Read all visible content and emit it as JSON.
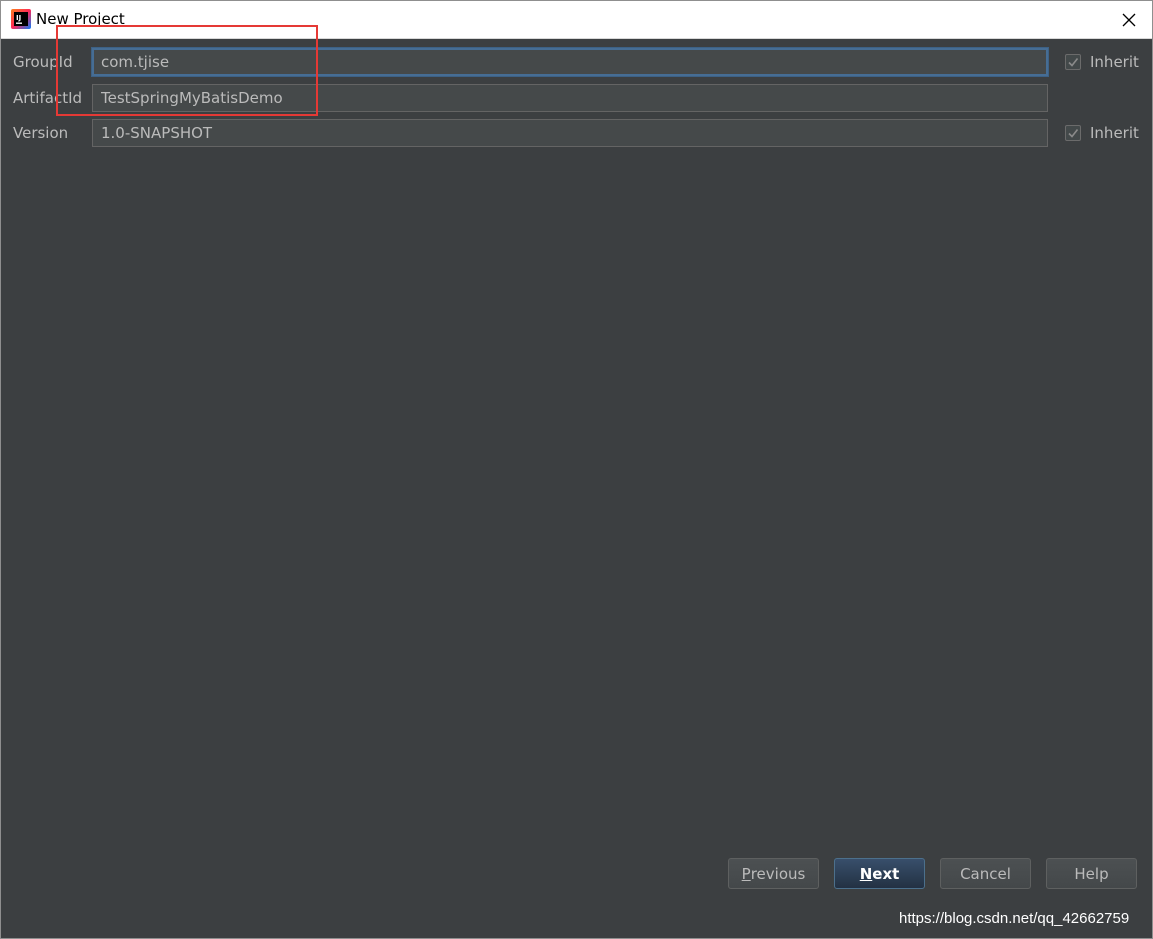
{
  "window": {
    "title": "New Project"
  },
  "fields": {
    "group_id": {
      "label": "GroupId",
      "value": "com.tjise"
    },
    "artifact_id": {
      "label": "ArtifactId",
      "value": "TestSpringMyBatisDemo"
    },
    "version": {
      "label": "Version",
      "value": "1.0-SNAPSHOT"
    }
  },
  "inherit": {
    "group_label": "Inherit",
    "group_checked": true,
    "version_label": "Inherit",
    "version_checked": true
  },
  "buttons": {
    "previous_mnemonic": "P",
    "previous_rest": "revious",
    "next_mnemonic": "N",
    "next_rest": "ext",
    "cancel_label": "Cancel",
    "help_label": "Help"
  },
  "watermark": "https://blog.csdn.net/qq_42662759",
  "icons": {
    "app": "intellij-idea-icon",
    "close": "close-icon",
    "check": "checkmark-icon"
  },
  "colors": {
    "background": "#3c3f41",
    "input_background": "#45494a",
    "text": "#bbbbbb",
    "focus_border": "#466d94",
    "highlight": "#e53935",
    "default_button": "#2c3e55"
  }
}
